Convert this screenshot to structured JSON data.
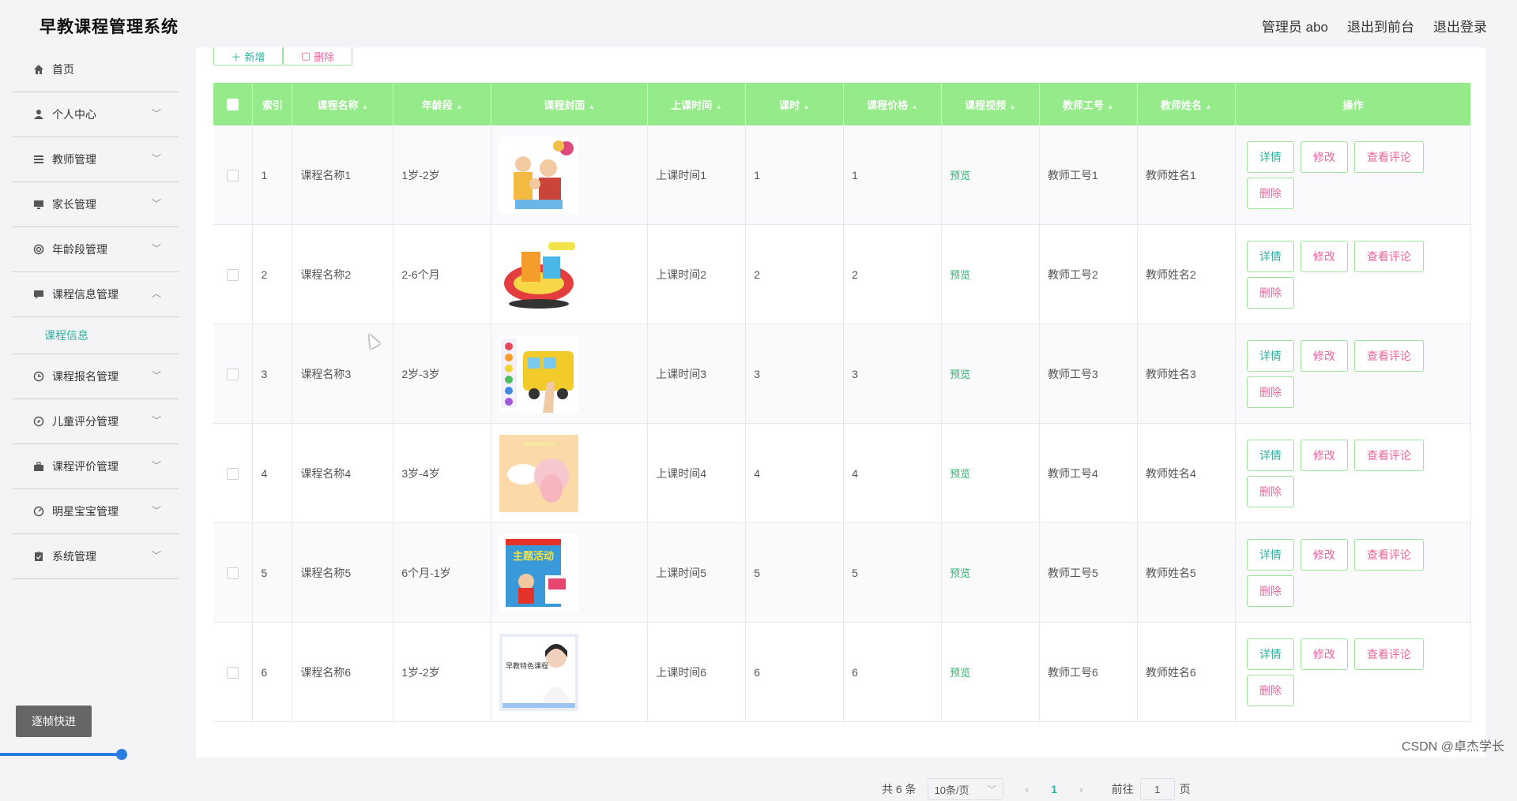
{
  "header": {
    "app_title": "早教课程管理系统",
    "admin_label": "管理员 abo",
    "exit_front": "退出到前台",
    "logout": "退出登录"
  },
  "sidebar": {
    "items": [
      {
        "label": "首页",
        "icon": "home-icon"
      },
      {
        "label": "个人中心",
        "icon": "user-icon"
      },
      {
        "label": "教师管理",
        "icon": "list-icon"
      },
      {
        "label": "家长管理",
        "icon": "monitor-icon"
      },
      {
        "label": "年龄段管理",
        "icon": "ring-icon"
      },
      {
        "label": "课程信息管理",
        "icon": "chat-icon"
      },
      {
        "label": "课程报名管理",
        "icon": "clock-icon"
      },
      {
        "label": "儿童评分管理",
        "icon": "compass-icon"
      },
      {
        "label": "课程评价管理",
        "icon": "briefcase-icon"
      },
      {
        "label": "明星宝宝管理",
        "icon": "gauge-icon"
      },
      {
        "label": "系统管理",
        "icon": "clipboard-icon"
      }
    ],
    "active_sub": "课程信息",
    "frame_button": "逐帧快进"
  },
  "toolbar": {
    "add_label": "新增",
    "delete_label": "删除"
  },
  "table": {
    "headers": [
      "索引",
      "课程名称",
      "年龄段",
      "课程封面",
      "上课时间",
      "课时",
      "课程价格",
      "课程视频",
      "教师工号",
      "教师姓名",
      "操作"
    ],
    "rows": [
      {
        "index": "1",
        "name": "课程名称1",
        "age": "1岁-2岁",
        "cover": "family-party",
        "time": "上课时间1",
        "hours": "1",
        "price": "1",
        "video": "预览",
        "tno": "教师工号1",
        "tname": "教师姓名1"
      },
      {
        "index": "2",
        "name": "课程名称2",
        "age": "2-6个月",
        "cover": "toy-track",
        "time": "上课时间2",
        "hours": "2",
        "price": "2",
        "video": "预览",
        "tno": "教师工号2",
        "tname": "教师姓名2"
      },
      {
        "index": "3",
        "name": "课程名称3",
        "age": "2岁-3岁",
        "cover": "school-bus-drawing",
        "time": "上课时间3",
        "hours": "3",
        "price": "3",
        "video": "预览",
        "tno": "教师工号3",
        "tname": "教师姓名3"
      },
      {
        "index": "4",
        "name": "课程名称4",
        "age": "3岁-4岁",
        "cover": "pink-illustration",
        "time": "上课时间4",
        "hours": "4",
        "price": "4",
        "video": "预览",
        "tno": "教师工号4",
        "tname": "教师姓名4"
      },
      {
        "index": "5",
        "name": "课程名称5",
        "age": "6个月-1岁",
        "cover": "activity-book",
        "time": "上课时间5",
        "hours": "5",
        "price": "5",
        "video": "预览",
        "tno": "教师工号5",
        "tname": "教师姓名5"
      },
      {
        "index": "6",
        "name": "课程名称6",
        "age": "1岁-2岁",
        "cover": "teacher-poster",
        "time": "上课时间6",
        "hours": "6",
        "price": "6",
        "video": "预览",
        "tno": "教师工号6",
        "tname": "教师姓名6"
      }
    ],
    "op_labels": {
      "detail": "详情",
      "edit": "修改",
      "review": "查看评论",
      "delete": "删除"
    },
    "cover_texts": {
      "book_title": "主题活动",
      "poster_title": "早教特色课程"
    }
  },
  "pagination": {
    "total": "共 6 条",
    "page_size": "10条/页",
    "current": "1",
    "goto_prefix": "前往",
    "goto_value": "1",
    "goto_suffix": "页"
  },
  "watermark": "CSDN @卓杰学长",
  "colors": {
    "header_green": "#95ea8a",
    "accent_teal": "#2bb3a3",
    "accent_pink": "#e6679e"
  }
}
